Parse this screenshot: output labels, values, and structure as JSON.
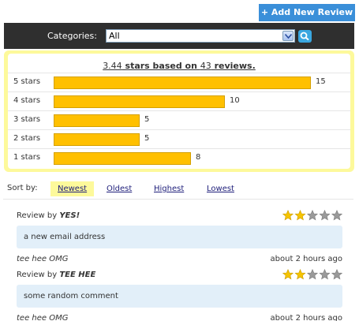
{
  "header": {
    "add_button_label": "+ Add New Review",
    "categories_label": "Categories:",
    "category_selected": "All"
  },
  "summary": {
    "average": "3.44",
    "average_suffix": " stars based on ",
    "count": "43",
    "count_suffix": " reviews.",
    "max_count": 15,
    "rows": [
      {
        "label": "5 stars",
        "count": 15
      },
      {
        "label": "4 stars",
        "count": 10
      },
      {
        "label": "3 stars",
        "count": 5
      },
      {
        "label": "2 stars",
        "count": 5
      },
      {
        "label": "1 stars",
        "count": 8
      }
    ],
    "bar_color": "#ffc000"
  },
  "sort": {
    "label": "Sort by:",
    "options": [
      "Newest",
      "Oldest",
      "Highest",
      "Lowest"
    ],
    "active": "Newest"
  },
  "reviews": [
    {
      "by_prefix": "Review by ",
      "reviewer": "YES!",
      "rating": 2,
      "comment": "a new email address",
      "author": "tee hee OMG",
      "time": "about 2 hours ago"
    },
    {
      "by_prefix": "Review by ",
      "reviewer": "TEE HEE",
      "rating": 2,
      "comment": "some random comment",
      "author": "tee hee OMG",
      "time": "about 2 hours ago"
    }
  ],
  "colors": {
    "accent": "#3a8fd9",
    "star_on": "#f5c400",
    "star_off": "#9a9a9a",
    "highlight": "#fdf99b"
  }
}
